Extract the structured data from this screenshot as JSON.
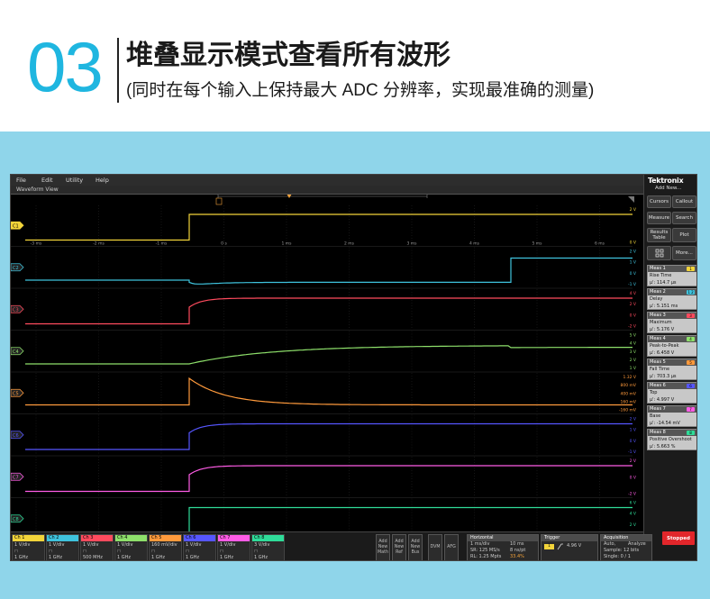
{
  "header": {
    "number": "03",
    "title": "堆叠显示模式查看所有波形",
    "subtitle": "(同时在每个输入上保持最大 ADC 分辨率，实现最准确的测量)"
  },
  "menu": [
    "File",
    "Edit",
    "Utility",
    "Help"
  ],
  "waveform_view": {
    "title": "Waveform View",
    "time_ticks": [
      "-3 ms",
      "-2 ms",
      "-1 ms",
      "0 s",
      "1 ms",
      "2 ms",
      "3 ms",
      "4 ms",
      "5 ms",
      "6 ms"
    ]
  },
  "channels": [
    {
      "id": "C1",
      "color": "#f2d43a",
      "scale": [
        "2 V",
        "0 V"
      ],
      "kind": "step_flat"
    },
    {
      "id": "C2",
      "color": "#3fc3dd",
      "scale": [
        "2 V",
        "1 V",
        "0 V",
        "-1 V"
      ],
      "kind": "dip_then_step"
    },
    {
      "id": "C3",
      "color": "#ff4b5e",
      "scale": [
        "4 V",
        "2 V",
        "0 V",
        "-2 V"
      ],
      "kind": "fast_rise"
    },
    {
      "id": "C4",
      "color": "#8ee06b",
      "scale": [
        "5 V",
        "4 V",
        "3 V",
        "2 V",
        "1 V"
      ],
      "kind": "slow_rise"
    },
    {
      "id": "C5",
      "color": "#ff9a3c",
      "scale": [
        "1.32 V",
        "800 mV",
        "400 mV",
        "160 mV",
        "-160 mV"
      ],
      "kind": "spike_decay"
    },
    {
      "id": "C6",
      "color": "#5656ff",
      "scale": [
        "2 V",
        "1 V",
        "0 V",
        "-1 V"
      ],
      "kind": "fast_rise"
    },
    {
      "id": "C7",
      "color": "#ff5ce6",
      "scale": [
        "2 V",
        "0 V",
        "-2 V"
      ],
      "kind": "fast_rise"
    },
    {
      "id": "C8",
      "color": "#2fdc99",
      "scale": [
        "6 V",
        "4 V",
        "2 V",
        "0 V"
      ],
      "kind": "step_flat"
    }
  ],
  "right_panel": {
    "brand": "Tektronix",
    "add_new": "Add New...",
    "buttons": [
      "Cursors",
      "Callout",
      "Measure",
      "Search",
      "Results Table",
      "Plot",
      "More..."
    ],
    "measurements": [
      {
        "head": "Meas 1",
        "badge": "1",
        "badge_color": "#f2d43a",
        "name": "Rise Time",
        "value": "μ': 114.7 μs"
      },
      {
        "head": "Meas 2",
        "badge": "1 2",
        "badge_color": "#3fc3dd",
        "name": "Delay",
        "value": "μ': 5.151 ms"
      },
      {
        "head": "Meas 3",
        "badge": "3",
        "badge_color": "#ff4b5e",
        "name": "Maximum",
        "value": "μ': 5.176 V"
      },
      {
        "head": "Meas 4",
        "badge": "4",
        "badge_color": "#8ee06b",
        "name": "Peak-to-Peak",
        "value": "μ': 6.458 V"
      },
      {
        "head": "Meas 5",
        "badge": "5",
        "badge_color": "#ff9a3c",
        "name": "Fall Time",
        "value": "μ': 703.3 μs"
      },
      {
        "head": "Meas 6",
        "badge": "6",
        "badge_color": "#5656ff",
        "name": "Top",
        "value": "μ': 4.997 V"
      },
      {
        "head": "Meas 7",
        "badge": "7",
        "badge_color": "#ff5ce6",
        "name": "Base",
        "value": "μ': -14.54 mV"
      },
      {
        "head": "Meas 8",
        "badge": "8",
        "badge_color": "#2fdc99",
        "name": "Positive Overshoot",
        "value": "μ': 5.663 %"
      }
    ]
  },
  "bottom": {
    "channel_badges": [
      {
        "label": "Ch 1",
        "color": "#f2d43a",
        "scale": "1 V/div",
        "bw": "1 GHz"
      },
      {
        "label": "Ch 2",
        "color": "#3fc3dd",
        "scale": "1 V/div",
        "bw": "1 GHz"
      },
      {
        "label": "Ch 3",
        "color": "#ff4b5e",
        "scale": "1 V/div",
        "bw": "500 MHz"
      },
      {
        "label": "Ch 4",
        "color": "#8ee06b",
        "scale": "1 V/div",
        "bw": "1 GHz"
      },
      {
        "label": "Ch 5",
        "color": "#ff9a3c",
        "scale": "160 mV/div",
        "bw": "1 GHz"
      },
      {
        "label": "Ch 6",
        "color": "#5656ff",
        "scale": "1 V/div",
        "bw": "1 GHz"
      },
      {
        "label": "Ch 7",
        "color": "#ff5ce6",
        "scale": "1 V/div",
        "bw": "1 GHz"
      },
      {
        "label": "Ch 8",
        "color": "#2fdc99",
        "scale": "3 V/div",
        "bw": "1 GHz"
      }
    ],
    "add_buttons": [
      [
        "Add",
        "New",
        "Math"
      ],
      [
        "Add",
        "New",
        "Ref"
      ],
      [
        "Add",
        "New",
        "Bus"
      ]
    ],
    "dvm": "DVM",
    "afg": "AFG",
    "horizontal": {
      "head": "Horizontal",
      "l1": "1 ms/div",
      "l1b": "10 ms",
      "l2": "SR: 125 MS/s",
      "l2b": "8 ns/pt",
      "l3": "RL: 1.25 Mpts",
      "l3b": "33.4%"
    },
    "trigger": {
      "head": "Trigger",
      "level": "4.96 V"
    },
    "acquisition": {
      "head": "Acquisition",
      "l1": "Auto,",
      "l1b": "Analyze",
      "l2": "Sample: 12 bits",
      "l3": "Single: 0 / 1"
    },
    "stopped": "Stopped"
  }
}
